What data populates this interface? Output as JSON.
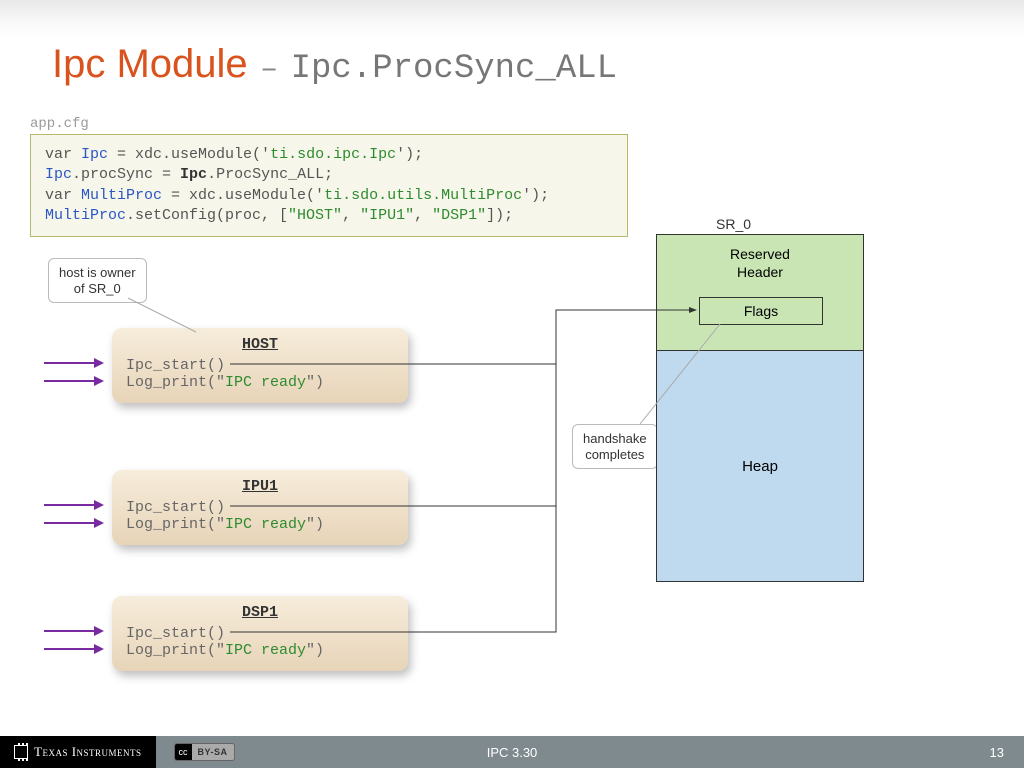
{
  "title": {
    "main": "Ipc Module",
    "dash": "–",
    "sub": "Ipc.ProcSync_ALL"
  },
  "cfg_label": "app.cfg",
  "code": {
    "l1a": "var ",
    "l1b": "Ipc",
    "l1c": " = xdc.useModule('",
    "l1d": "ti.sdo.ipc.Ipc",
    "l1e": "');",
    "l2a": "Ipc",
    "l2b": ".procSync = ",
    "l2c": "Ipc",
    "l2d": ".ProcSync_ALL;",
    "l3a": "var ",
    "l3b": "MultiProc",
    "l3c": " = xdc.useModule('",
    "l3d": "ti.sdo.utils.MultiProc",
    "l3e": "');",
    "l4a": "MultiProc",
    "l4b": ".setConfig(proc, [",
    "l4c": "\"HOST\"",
    "l4d": ", ",
    "l4e": "\"IPU1\"",
    "l4f": ", ",
    "l4g": "\"DSP1\"",
    "l4h": "]);"
  },
  "labels": {
    "host_owner": "host is owner\nof SR_0",
    "handshake": "handshake\ncompletes"
  },
  "procs": {
    "host": {
      "name": "HOST",
      "ln1": "Ipc_start()",
      "ln2a": "Log_print(\"",
      "ln2b": "IPC ready",
      "ln2c": "\")"
    },
    "ipu1": {
      "name": "IPU1",
      "ln1": "Ipc_start()",
      "ln2a": "Log_print(\"",
      "ln2b": "IPC ready",
      "ln2c": "\")"
    },
    "dsp1": {
      "name": "DSP1",
      "ln1": "Ipc_start()",
      "ln2a": "Log_print(\"",
      "ln2b": "IPC ready",
      "ln2c": "\")"
    }
  },
  "sr0": {
    "label": "SR_0",
    "header": "Reserved\nHeader",
    "flags": "Flags",
    "heap": "Heap"
  },
  "footer": {
    "ti": "Texas Instruments",
    "cc1": "cc",
    "cc2": "BY-SA",
    "center": "IPC 3.30",
    "page": "13"
  }
}
